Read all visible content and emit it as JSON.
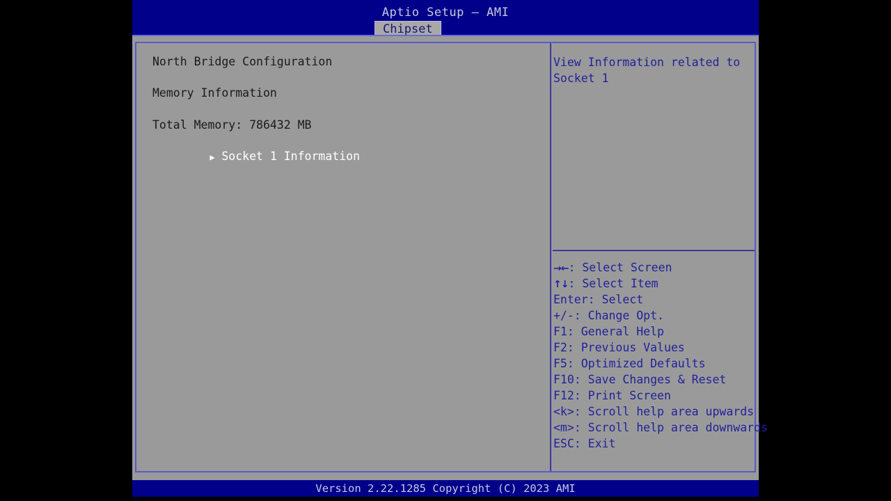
{
  "colors": {
    "header_blue": "#00008b",
    "panel_gray": "#9a9a9a",
    "border_violet": "#5a5ac8",
    "help_blue": "#21219c",
    "selected_white": "#ffffff",
    "normal_text": "#1a1a1a",
    "tab_gray": "#a8a8a8",
    "tab_text": "#141478"
  },
  "header": {
    "title": "Aptio Setup – AMI",
    "active_tab": "Chipset"
  },
  "left_pane": {
    "section_title": "North Bridge Configuration",
    "group_title": "Memory Information",
    "total_memory_label": "Total Memory: 786432 MB",
    "selected_item": {
      "label": "Socket 1 Information",
      "marker": "▶",
      "is_selected": true
    }
  },
  "right_pane": {
    "help_text": "View Information related to Socket 1",
    "keys": [
      {
        "glyph": "→←",
        "text": ": Select Screen"
      },
      {
        "glyph": "↑↓",
        "text": ": Select Item"
      },
      {
        "glyph": "",
        "text": "Enter: Select"
      },
      {
        "glyph": "",
        "text": "+/-: Change Opt."
      },
      {
        "glyph": "",
        "text": "F1: General Help"
      },
      {
        "glyph": "",
        "text": "F2: Previous Values"
      },
      {
        "glyph": "",
        "text": "F5: Optimized Defaults"
      },
      {
        "glyph": "",
        "text": "F10: Save Changes & Reset"
      },
      {
        "glyph": "",
        "text": "F12: Print Screen"
      },
      {
        "glyph": "",
        "text": "<k>: Scroll help area upwards"
      },
      {
        "glyph": "",
        "text": "<m>: Scroll help area downwards"
      },
      {
        "glyph": "",
        "text": "ESC: Exit"
      }
    ]
  },
  "footer": {
    "version_text": "Version 2.22.1285 Copyright (C) 2023 AMI"
  }
}
